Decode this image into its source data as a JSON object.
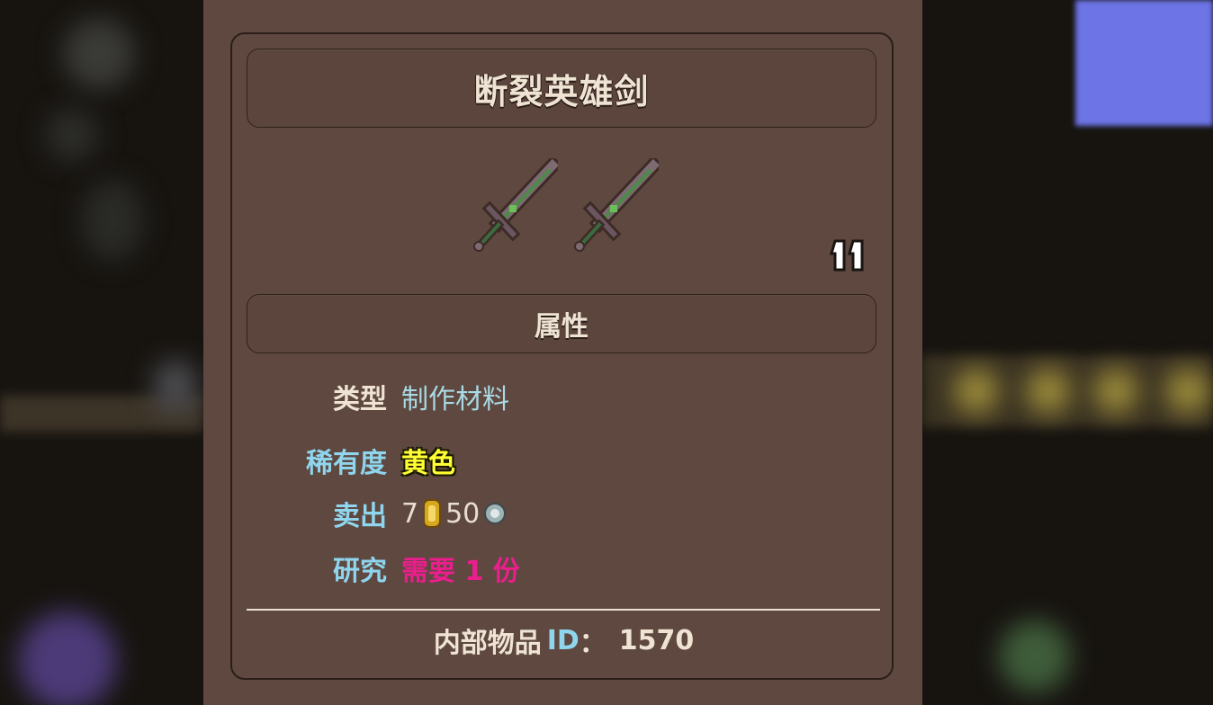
{
  "item": {
    "name": "断裂英雄剑",
    "stack_count": "11",
    "section_title": "属性",
    "rows": [
      {
        "label": "类型",
        "value": "制作材料"
      },
      {
        "label": "稀有度",
        "value": "黄色"
      },
      {
        "label": "卖出",
        "gold": "7",
        "silver": "50"
      },
      {
        "label": "研究",
        "value": "需要 1 份"
      }
    ],
    "footer": {
      "prefix": "内部物品",
      "id_label": "ID",
      "colon": "：",
      "id_value": "1570"
    }
  },
  "icons": {
    "sprite": "broken-hero-sword-icon",
    "gold": "gold-coin-icon",
    "silver": "silver-coin-icon",
    "stack": "pause-icon"
  },
  "colors": {
    "panel": "#5e4840",
    "rarity_yellow": "#ffff33",
    "research_pink": "#ea1e8c",
    "label_blue": "#8fd5ee"
  }
}
